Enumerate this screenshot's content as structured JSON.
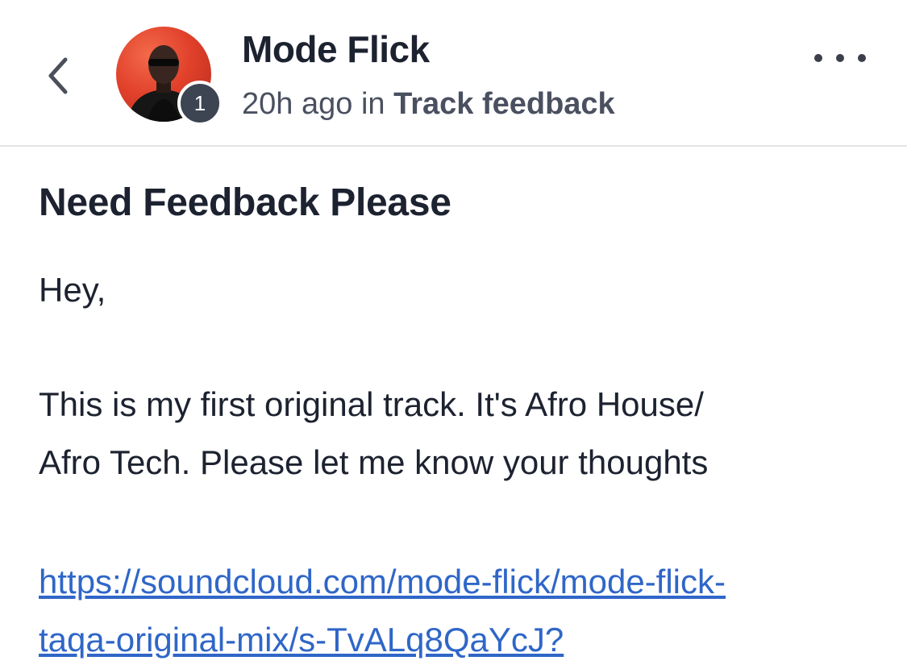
{
  "header": {
    "author_name": "Mode Flick",
    "badge_count": "1",
    "time_ago": "20h ago",
    "in_word": "in",
    "category": "Track feedback"
  },
  "post": {
    "title": "Need Feedback Please",
    "greeting": "Hey,",
    "body_line1": "This is my first original track. It's Afro House/",
    "body_line2": "Afro Tech. Please let me know your thoughts",
    "link_line1": "https://soundcloud.com/mode-flick/mode-flick-",
    "link_line2": "taqa-original-mix/s-TvALq8QaYcJ?"
  },
  "icons": {
    "back": "chevron-left-icon",
    "more": "more-horizontal-icon"
  },
  "colors": {
    "text": "#1d2230",
    "link": "#2f66c8",
    "badge": "#3d4452",
    "avatar_bg": "#e1412b"
  }
}
